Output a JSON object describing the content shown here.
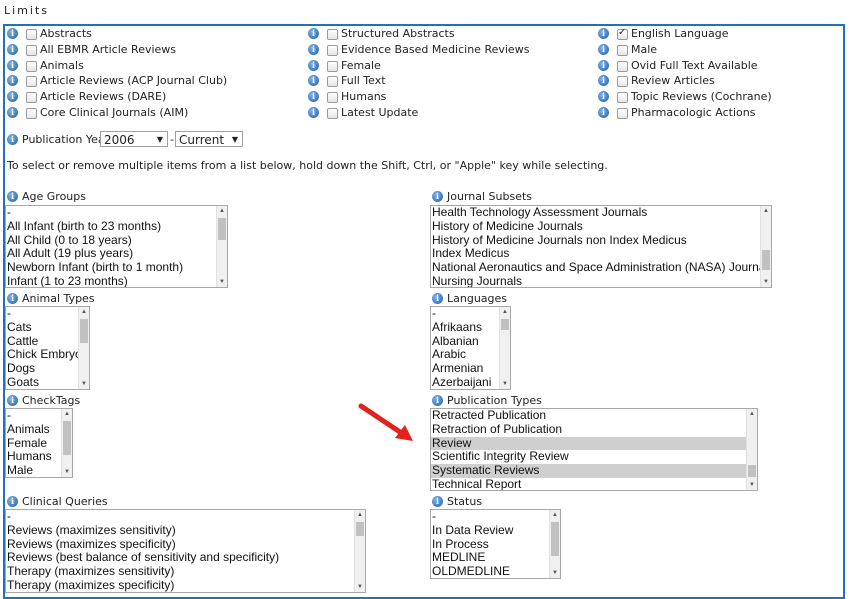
{
  "title": "Limits",
  "limits_col1": [
    "Abstracts",
    "All EBMR Article Reviews",
    "Animals",
    "Article Reviews (ACP Journal Club)",
    "Article Reviews (DARE)",
    "Core Clinical Journals (AIM)"
  ],
  "limits_col2": [
    "Structured Abstracts",
    "Evidence Based Medicine Reviews",
    "Female",
    "Full Text",
    "Humans",
    "Latest Update"
  ],
  "limits_col3": [
    "English Language",
    "Male",
    "Ovid Full Text Available",
    "Review Articles",
    "Topic Reviews (Cochrane)",
    "Pharmacologic Actions"
  ],
  "checked_col3": [
    true,
    false,
    false,
    false,
    false,
    false
  ],
  "pub_year": {
    "label": "Publication Year",
    "from": "2006",
    "sep": "-",
    "to": "Current"
  },
  "hint": "To select or remove multiple items from a list below, hold down the Shift, Ctrl, or \"Apple\" key while selecting.",
  "age_groups": {
    "label": "Age Groups",
    "options": [
      "-",
      "All Infant (birth to 23 months)",
      "All Child (0 to 18 years)",
      "All Adult (19 plus years)",
      "Newborn Infant (birth to 1 month)",
      "Infant (1 to 23 months)"
    ]
  },
  "journal_subsets": {
    "label": "Journal Subsets",
    "options": [
      "Health Technology Assessment Journals",
      "History of Medicine Journals",
      "History of Medicine Journals non Index Medicus",
      "Index Medicus",
      "National Aeronautics and Space Administration (NASA) Journals",
      "Nursing Journals"
    ]
  },
  "animal_types": {
    "label": "Animal Types",
    "options": [
      "-",
      "Cats",
      "Cattle",
      "Chick Embryo",
      "Dogs",
      "Goats"
    ]
  },
  "languages": {
    "label": "Languages",
    "options": [
      "-",
      "Afrikaans",
      "Albanian",
      "Arabic",
      "Armenian",
      "Azerbaijani"
    ]
  },
  "checktags": {
    "label": "CheckTags",
    "options": [
      "-",
      "Animals",
      "Female",
      "Humans",
      "Male"
    ]
  },
  "publication_types": {
    "label": "Publication Types",
    "options": [
      "Retracted Publication",
      "Retraction of Publication",
      "Review",
      "Scientific Integrity Review",
      "Systematic Reviews",
      "Technical Report"
    ],
    "selected": [
      false,
      false,
      true,
      false,
      true,
      false
    ]
  },
  "clinical_queries": {
    "label": "Clinical Queries",
    "options": [
      "-",
      "Reviews (maximizes sensitivity)",
      "Reviews (maximizes specificity)",
      "Reviews (best balance of sensitivity and specificity)",
      "Therapy (maximizes sensitivity)",
      "Therapy (maximizes specificity)"
    ]
  },
  "status": {
    "label": "Status",
    "options": [
      "-",
      "In Data Review",
      "In Process",
      "MEDLINE",
      "OLDMEDLINE"
    ]
  },
  "colors": {
    "border": "#1f73b9",
    "arrow": "#e0231c",
    "selected": "#cfcfcf"
  }
}
